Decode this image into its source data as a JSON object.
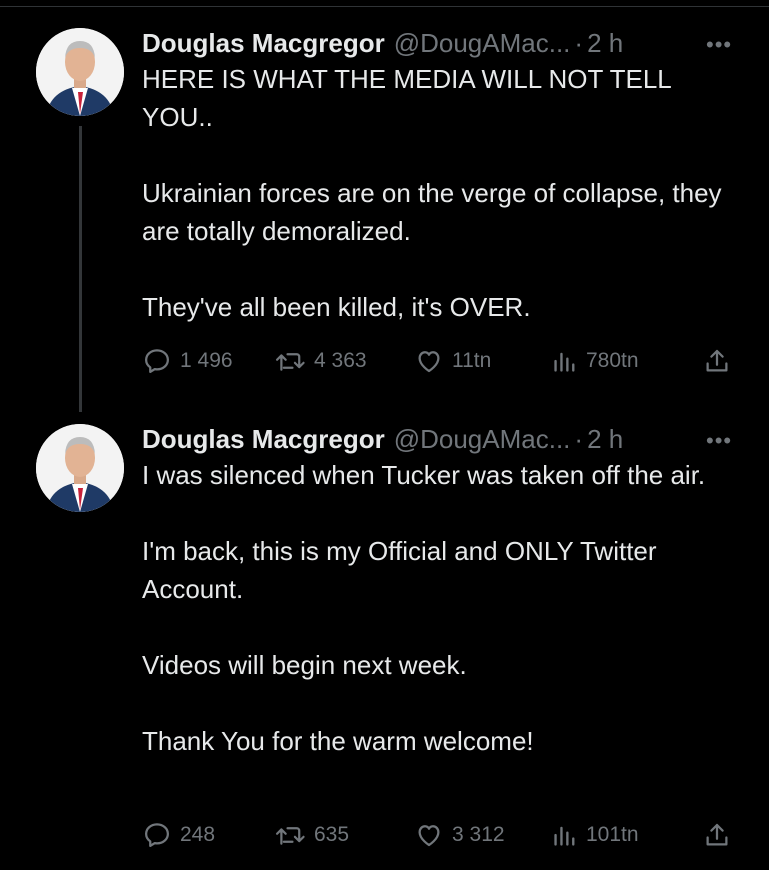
{
  "tweets": [
    {
      "author_name": "Douglas Macgregor",
      "handle": "@DougAMac...",
      "time": "2 h",
      "more": "•••",
      "paragraphs": [
        "HERE IS WHAT THE MEDIA WILL NOT TELL YOU..",
        "Ukrainian forces are on the verge of collapse, they are totally demoralized.",
        "They've all been killed, it's OVER."
      ],
      "replies": "1 496",
      "retweets": "4 363",
      "likes": "11tn",
      "views": "780tn"
    },
    {
      "author_name": "Douglas Macgregor",
      "handle": "@DougAMac...",
      "time": "2 h",
      "more": "•••",
      "paragraphs": [
        "I was silenced when Tucker was taken off the air.",
        "I'm back, this is my Official and ONLY Twitter Account.",
        "Videos will begin next week.",
        "Thank You for the warm welcome!"
      ],
      "replies": "248",
      "retweets": "635",
      "likes": "3 312",
      "views": "101tn"
    }
  ],
  "colors": {
    "background": "#000000",
    "text": "#e7e9ea",
    "muted": "#71767b",
    "thread_line": "#333639"
  },
  "icons": [
    "reply-icon",
    "retweet-icon",
    "like-icon",
    "views-icon",
    "share-icon",
    "more-icon"
  ]
}
